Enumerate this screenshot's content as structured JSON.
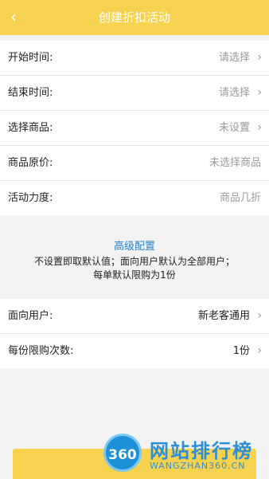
{
  "header": {
    "back_icon": "chevron-left-icon",
    "title": "创建折扣活动"
  },
  "form_top": [
    {
      "label": "开始时间:",
      "value": "请选择",
      "arrow": true
    },
    {
      "label": "结束时间:",
      "value": "请选择",
      "arrow": true
    },
    {
      "label": "选择商品:",
      "value": "未设置",
      "arrow": true
    },
    {
      "label": "商品原价:",
      "value": "未选择商品",
      "arrow": false
    },
    {
      "label": "活动力度:",
      "value": "商品几折",
      "arrow": false
    }
  ],
  "advanced": {
    "heading": "高级配置",
    "line1": "不设置即取默认值；面向用户默认为全部用户；",
    "line2": "每单默认限购为1份"
  },
  "form_bottom": [
    {
      "label": "面向用户:",
      "value": "新老客通用",
      "arrow": true
    },
    {
      "label": "每份限购次数:",
      "value": "1份",
      "arrow": true
    }
  ],
  "watermark": {
    "badge": "360",
    "name": "网站排行榜",
    "domain": "WANGZHAN360.CN"
  },
  "colors": {
    "accent": "#f7d24f",
    "link": "#2b82c9",
    "watermark": "#2c8fd6"
  }
}
